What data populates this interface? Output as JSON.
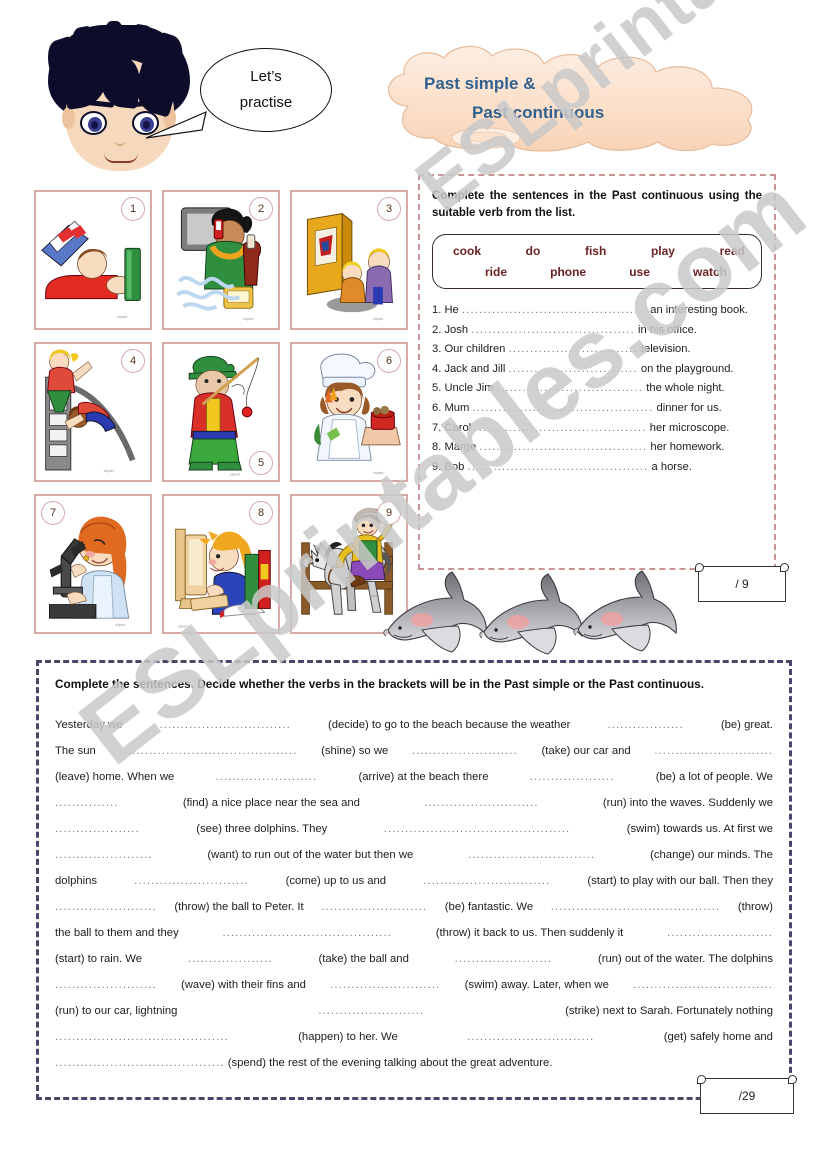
{
  "page": {
    "watermark_a": "ESLprintables.com",
    "watermark_b": "ESLprintables.com"
  },
  "header": {
    "speech_bubble_line1": "Let’s",
    "speech_bubble_line2": "practise",
    "title_line1": "Past simple &",
    "title_line2": "Past continuous",
    "title_color": "#31618f",
    "cloud_color": "#fbe0cc"
  },
  "pictures": [
    {
      "number": "1",
      "num_pos": "num-tr",
      "alt": "boy lying in bed reading a book"
    },
    {
      "number": "2",
      "num_pos": "num-tr",
      "alt": "person talking on a mobile phone in an office"
    },
    {
      "number": "3",
      "num_pos": "num-tr",
      "alt": "two children watching television"
    },
    {
      "number": "4",
      "num_pos": "num-tr",
      "alt": "children playing on a slide in the playground"
    },
    {
      "number": "5",
      "num_pos": "num-br",
      "alt": "man fishing with a fishing rod"
    },
    {
      "number": "6",
      "num_pos": "num-tr",
      "alt": "woman cooking dinner in a chef hat"
    },
    {
      "number": "7",
      "num_pos": "num-tl",
      "alt": "woman using a microscope"
    },
    {
      "number": "8",
      "num_pos": "num-tr",
      "alt": "girl doing homework at a computer"
    },
    {
      "number": "9",
      "num_pos": "num-tr",
      "alt": "boy riding a horse"
    }
  ],
  "exercise1": {
    "instruction": "Complete the sentences in the Past continuous using the suitable verb from the list.",
    "wordbank_row1": [
      "cook",
      "do",
      "fish",
      "play",
      "read"
    ],
    "wordbank_row2": [
      "ride",
      "phone",
      "use",
      "watch"
    ],
    "wordbank_color": "#6b2323",
    "sentences": [
      {
        "num": "1.",
        "before": "He",
        "dots": "...........................................",
        "after": "an interesting book."
      },
      {
        "num": "2.",
        "before": "Josh",
        "dots": "......................................",
        "after": "in his office."
      },
      {
        "num": "3.",
        "before": "Our children",
        "dots": "..............................",
        "after": "television."
      },
      {
        "num": "4.",
        "before": "Jack and Jill",
        "dots": "..............................",
        "after": "on the playground."
      },
      {
        "num": "5.",
        "before": "Uncle Jim",
        "dots": "..................................",
        "after": "the whole night."
      },
      {
        "num": "6.",
        "before": "Mum",
        "dots": "..........................................",
        "after": "dinner for us."
      },
      {
        "num": "7.",
        "before": "Carol",
        "dots": "........................................",
        "after": "her microscope."
      },
      {
        "num": "8.",
        "before": "Marge",
        "dots": ".......................................",
        "after": "her homework."
      },
      {
        "num": "9.",
        "before": "Bob",
        "dots": "..........................................",
        "after": "a horse."
      }
    ],
    "score": "/ 9"
  },
  "exercise2": {
    "instruction": "Complete the sentences. Decide whether the verbs in the brackets will be in the Past simple or the Past continuous.",
    "lines": [
      [
        "Yesterday we",
        "...............................",
        "(decide) to go to the beach because the weather",
        "..................",
        "(be) great."
      ],
      [
        "The sun",
        "..........................................",
        "(shine) so we",
        ".........................",
        "(take) our car and",
        "............................"
      ],
      [
        "(leave) home. When we",
        "........................",
        "(arrive) at the beach there",
        "....................",
        "(be) a lot of people. We"
      ],
      [
        "...............",
        "(find) a nice place near the sea and",
        "...........................",
        "(run) into the waves. Suddenly we"
      ],
      [
        "....................",
        "(see) three dolphins. They",
        "............................................",
        "(swim) towards us. At first we"
      ],
      [
        ".......................",
        "(want) to run out of the water but then we",
        "..............................",
        "(change) our minds. The"
      ],
      [
        "dolphins",
        "...........................",
        "(come) up to us and",
        "..............................",
        "(start) to play with our ball. Then they"
      ],
      [
        "........................",
        "(throw) the ball to Peter. It",
        ".........................",
        "(be) fantastic. We",
        "........................................",
        "(throw)"
      ],
      [
        "the ball to them and they",
        "........................................",
        "(throw) it back to us. Then suddenly it",
        "........................."
      ],
      [
        "(start) to rain. We",
        "....................",
        "(take) the ball and",
        ".......................",
        "(run) out of the water. The dolphins"
      ],
      [
        "........................",
        "(wave) with their fins and",
        "..........................",
        "(swim) away. Later, when we",
        "................................."
      ],
      [
        "(run) to our car, lightning",
        ".........................",
        "(strike) next to Sarah. Fortunately nothing"
      ],
      [
        ".........................................",
        "(happen) to her. We",
        "..............................",
        "(get) safely home and"
      ],
      [
        "........................................",
        "(spend) the rest of the evening talking about the great adventure."
      ]
    ],
    "score": "/29",
    "border_color": "#4b4668"
  }
}
